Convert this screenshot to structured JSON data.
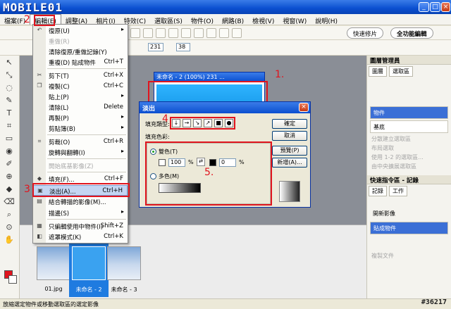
{
  "app": {
    "logo_text": "MOBILE01",
    "window_buttons": [
      "_",
      "□",
      "×"
    ]
  },
  "menubar": {
    "items": [
      "檔案(F)",
      "編輯(E)",
      "調整(A)",
      "相片(I)",
      "特效(C)",
      "選取區(S)",
      "物件(O)",
      "網路(B)",
      "檢視(V)",
      "視窗(W)",
      "說明(H)"
    ],
    "active_index": 1
  },
  "mode_tabs": {
    "quick": "快速修片",
    "full": "全功能編輯"
  },
  "toolbar2": {
    "value_a": "231",
    "value_b": "38"
  },
  "edit_menu": {
    "items": [
      {
        "label": "復原(U)",
        "shortcut": "",
        "submenu": true,
        "disabled": false
      },
      {
        "label": "重做(R)",
        "shortcut": "",
        "submenu": false,
        "disabled": true
      },
      {
        "label": "清除復原/重做記錄(Y)",
        "shortcut": "",
        "submenu": false,
        "disabled": false
      },
      {
        "label": "重複(D) 貼成物件",
        "shortcut": "Ctrl+T",
        "submenu": false,
        "disabled": false
      },
      {
        "label": "剪下(T)",
        "shortcut": "Ctrl+X",
        "submenu": false,
        "disabled": false
      },
      {
        "label": "複製(C)",
        "shortcut": "Ctrl+C",
        "submenu": false,
        "disabled": false
      },
      {
        "label": "貼上(P)",
        "shortcut": "",
        "submenu": true,
        "disabled": false
      },
      {
        "label": "清除(L)",
        "shortcut": "Delete",
        "submenu": false,
        "disabled": false
      },
      {
        "label": "再製(P)",
        "shortcut": "",
        "submenu": true,
        "disabled": false
      },
      {
        "label": "剪貼簿(B)",
        "shortcut": "",
        "submenu": true,
        "disabled": false
      },
      {
        "label": "剪裁(O)",
        "shortcut": "Ctrl+R",
        "submenu": false,
        "disabled": false
      },
      {
        "label": "旋轉與翻轉(I)",
        "shortcut": "",
        "submenu": true,
        "disabled": false
      },
      {
        "label": "開始底基影像(Z)",
        "shortcut": "",
        "submenu": false,
        "disabled": true
      },
      {
        "label": "填充(F)...",
        "shortcut": "Ctrl+F",
        "submenu": false,
        "disabled": false
      },
      {
        "label": "淡出(A)...",
        "shortcut": "Ctrl+H",
        "submenu": false,
        "disabled": false,
        "highlight": true
      },
      {
        "label": "結合轉描的影像(M)...",
        "shortcut": "",
        "submenu": false,
        "disabled": false
      },
      {
        "label": "描邊(S)",
        "shortcut": "",
        "submenu": true,
        "disabled": false
      },
      {
        "label": "只編輯使用中物件(I)",
        "shortcut": "Shift+Z",
        "submenu": false,
        "disabled": false
      },
      {
        "label": "遮罩模式(K)",
        "shortcut": "Ctrl+K",
        "submenu": false,
        "disabled": false
      }
    ]
  },
  "image_window": {
    "title": "未命名 - 2 (100%) 231 ..."
  },
  "fade_dialog": {
    "title": "淡出",
    "fill_direction_label": "填充類型:",
    "fill_color_label": "填充色彩:",
    "direction_buttons": [
      "↓",
      "→",
      "↘",
      "↗",
      "■",
      "●"
    ],
    "ok": "確定",
    "cancel": "取消",
    "preview": "預覽(P)",
    "new": "新增(A)...",
    "gradient_option": "雙色(T)",
    "multi_option": "多色(M)",
    "left_value": "100",
    "right_value": "0",
    "percent": "%"
  },
  "annotations": {
    "n1": "1.",
    "n2": "2",
    "n3": "3",
    "n4": "4",
    "n5": "5."
  },
  "right_panel": {
    "layer_manager_title": "圖層管理員",
    "layer_tabs": [
      "圖層",
      "選取區"
    ],
    "layer_items": [
      "物件",
      "基底"
    ],
    "dim_items": [
      "分散建立選取區",
      "布局選取",
      "使用 1-2 的選取區...",
      "由中央擴展選取區"
    ],
    "history_title": "快速指令區 - 記錄",
    "history_tabs": [
      "記錄",
      "工作"
    ],
    "history_items": [
      "開新影像",
      "貼成物件"
    ],
    "history_dim": [
      "複製文件"
    ]
  },
  "filmstrip": {
    "thumbs": [
      "01.jpg",
      "未命名 - 2",
      "未命名 - 3"
    ]
  },
  "statusbar": {
    "text": "放縮選定物件或移動選取區的選定影像",
    "watermark": "#36217"
  },
  "colors": {
    "accent": "#0a4fd0",
    "highlight_red": "#e0141e",
    "primary_swatch": "#e0141e",
    "secondary_swatch": "#ffffff"
  }
}
